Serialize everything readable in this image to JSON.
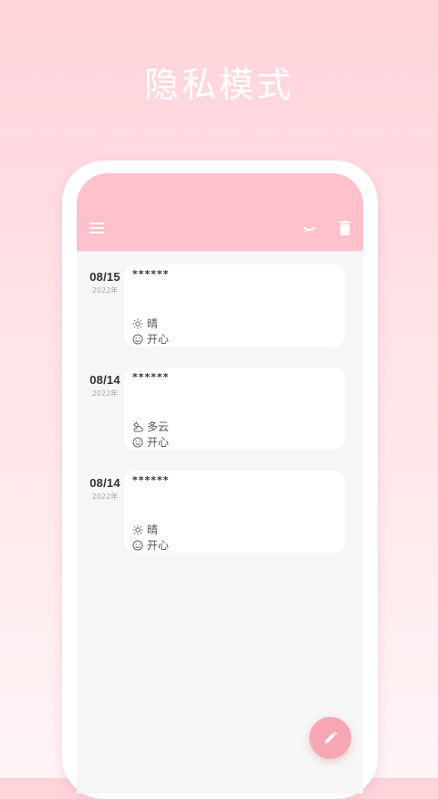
{
  "headline": "隐私模式",
  "appbar": {
    "menu_icon": "menu-icon",
    "hide_icon": "eye-closed-icon",
    "delete_icon": "trash-icon"
  },
  "entries": [
    {
      "date": "08/15",
      "year": "2022年",
      "content": "******",
      "weather": "晴",
      "weather_icon": "sun-icon",
      "mood": "开心",
      "mood_icon": "smile-icon"
    },
    {
      "date": "08/14",
      "year": "2022年",
      "content": "******",
      "weather": "多云",
      "weather_icon": "cloud-sun-icon",
      "mood": "开心",
      "mood_icon": "smile-icon"
    },
    {
      "date": "08/14",
      "year": "2022年",
      "content": "******",
      "weather": "晴",
      "weather_icon": "sun-icon",
      "mood": "开心",
      "mood_icon": "smile-icon"
    }
  ],
  "fab": {
    "icon": "pencil-icon"
  },
  "colors": {
    "accent": "#ffc1cb",
    "fab": "#f7a7b3",
    "background_top": "#ffd3da"
  }
}
